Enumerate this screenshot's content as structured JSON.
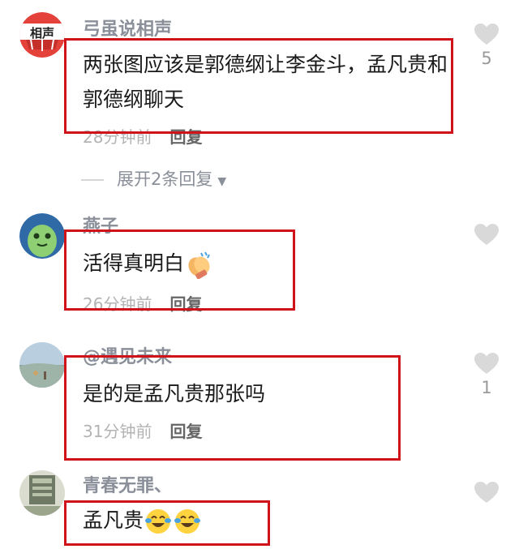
{
  "comments": [
    {
      "username": "弓虽说相声",
      "avatar_text": "相声",
      "content": "两张图应该是郭德纲让李金斗，孟凡贵和郭德纲聊天",
      "time": "28分钟前",
      "reply_label": "回复",
      "likes": "5",
      "expand_label": "展开2条回复"
    },
    {
      "username": "燕子",
      "content": "活得真明白",
      "emoji": "clapping-hands",
      "time": "26分钟前",
      "reply_label": "回复",
      "likes": ""
    },
    {
      "username": "@遇见未来",
      "content": "是的是孟凡贵那张吗",
      "time": "31分钟前",
      "reply_label": "回复",
      "likes": "1"
    },
    {
      "username": "青春无罪、",
      "content": "孟凡贵",
      "emoji": "crying-laughing-face",
      "likes": ""
    }
  ],
  "colors": {
    "highlight_box": "#d0121b",
    "username": "#8a8f99",
    "heart": "#d9d9d9"
  }
}
